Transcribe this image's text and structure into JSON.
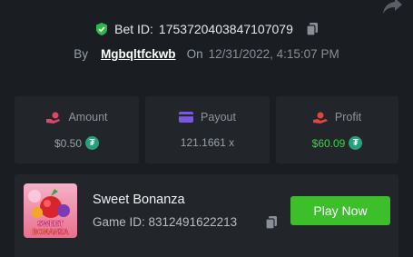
{
  "bet": {
    "label": "Bet ID:",
    "id": "1753720403847107079"
  },
  "by": {
    "by_label": "By",
    "username": "Mgbqltfckwb",
    "on_label": "On",
    "date": "12/31/2022, 4:15:07 PM"
  },
  "stats": {
    "amount": {
      "label": "Amount",
      "value": "$0.50",
      "currency_icon": "tether-icon"
    },
    "payout": {
      "label": "Payout",
      "value": "121.1661 x"
    },
    "profit": {
      "label": "Profit",
      "value": "$60.09",
      "currency_icon": "tether-icon"
    }
  },
  "game": {
    "title": "Sweet Bonanza",
    "id_label": "Game ID: 8312491622213",
    "play_label": "Play Now",
    "thumb_text_1": "SWEET",
    "thumb_text_2": "BONANZA"
  },
  "icons": {
    "tether_glyph": "₮"
  },
  "colors": {
    "background": "#1a1d21",
    "card": "#22262b",
    "accent_green": "#3cbf2b",
    "profit_green": "#3ed14a",
    "shield_green": "#2fb84a",
    "amount_icon": "#e0456a",
    "payout_icon": "#7b57e6",
    "profit_icon": "#e4453c",
    "tether": "#26a17b"
  }
}
